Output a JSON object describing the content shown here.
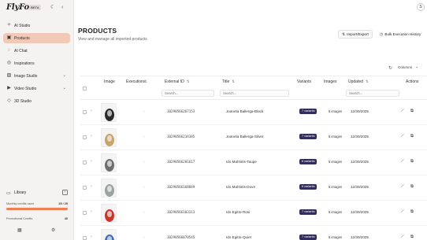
{
  "app": {
    "logo": "FlyFox",
    "beta_badge": "BETA"
  },
  "sidebar": {
    "items": [
      {
        "label": "AI Studio",
        "icon": "sparkle-icon",
        "glyph": "✧",
        "active": false,
        "expandable": false
      },
      {
        "label": "Products",
        "icon": "box-icon",
        "glyph": "▣",
        "active": true,
        "expandable": false
      },
      {
        "label": "AI Chat",
        "icon": "chat-icon",
        "glyph": "◌",
        "active": false,
        "expandable": false
      },
      {
        "label": "Inspirations",
        "icon": "bulb-icon",
        "glyph": "◎",
        "active": false,
        "expandable": false
      },
      {
        "label": "Image Studio",
        "icon": "image-icon",
        "glyph": "▨",
        "active": false,
        "expandable": true
      },
      {
        "label": "Video Studio",
        "icon": "video-icon",
        "glyph": "▶",
        "active": false,
        "expandable": true
      },
      {
        "label": "3D Studio",
        "icon": "cube-icon",
        "glyph": "◇",
        "active": false,
        "expandable": false
      }
    ],
    "library_label": "Library",
    "monthly_credits_label": "Monthly credits used",
    "monthly_credits_value": "25 / 25",
    "monthly_credits_fraction": 1.0,
    "promotional_credits_label": "Promotional Credits",
    "promotional_credits_value": "40"
  },
  "header": {
    "avatar_initial": "S",
    "title": "PRODUCTS",
    "subtitle": "View and manage all imported products",
    "import_export_label": "Import/Export",
    "bulk_history_label": "Bulk Execution History",
    "columns_label": "Columns"
  },
  "table": {
    "columns": {
      "image": "Image",
      "executions": "Executions",
      "external_id": "External ID",
      "title": "Title",
      "variants": "Variants",
      "images": "Images",
      "updated": "Updated",
      "actions": "Actions"
    },
    "search_placeholder": "Search...",
    "rows": [
      {
        "executions": "-",
        "external_id": "10290566267153",
        "title": "Joaneta Ballerga-Black",
        "variants": "7 variants",
        "images": "6 images",
        "updated": "12/30/2025"
      },
      {
        "executions": "-",
        "external_id": "10290566234385",
        "title": "Joaneta Ballerga-Silver",
        "variants": "7 variants",
        "images": "6 images",
        "updated": "12/30/2025"
      },
      {
        "executions": "-",
        "external_id": "10290566201617",
        "title": "Ido Mahlotis-Taupe",
        "variants": "6 variants",
        "images": "5 images",
        "updated": "12/30/2025"
      },
      {
        "executions": "-",
        "external_id": "10290566168849",
        "title": "Ido Mahlotis-Dove",
        "variants": "6 variants",
        "images": "6 images",
        "updated": "12/30/2025"
      },
      {
        "executions": "-",
        "external_id": "10290566103313",
        "title": "Ido Egitto-Rosi",
        "variants": "7 variants",
        "images": "6 images",
        "updated": "12/30/2025"
      },
      {
        "executions": "-",
        "external_id": "10290566070545",
        "title": "Ido Egitto-Quiet",
        "variants": "7 variants",
        "images": "6 images",
        "updated": "12/30/2025"
      }
    ],
    "thumb_colors": [
      "#2b2b2b",
      "#c8a46a",
      "#6e6e6e",
      "#9aa3a0",
      "#c8362b",
      "#3f6fb4"
    ]
  }
}
